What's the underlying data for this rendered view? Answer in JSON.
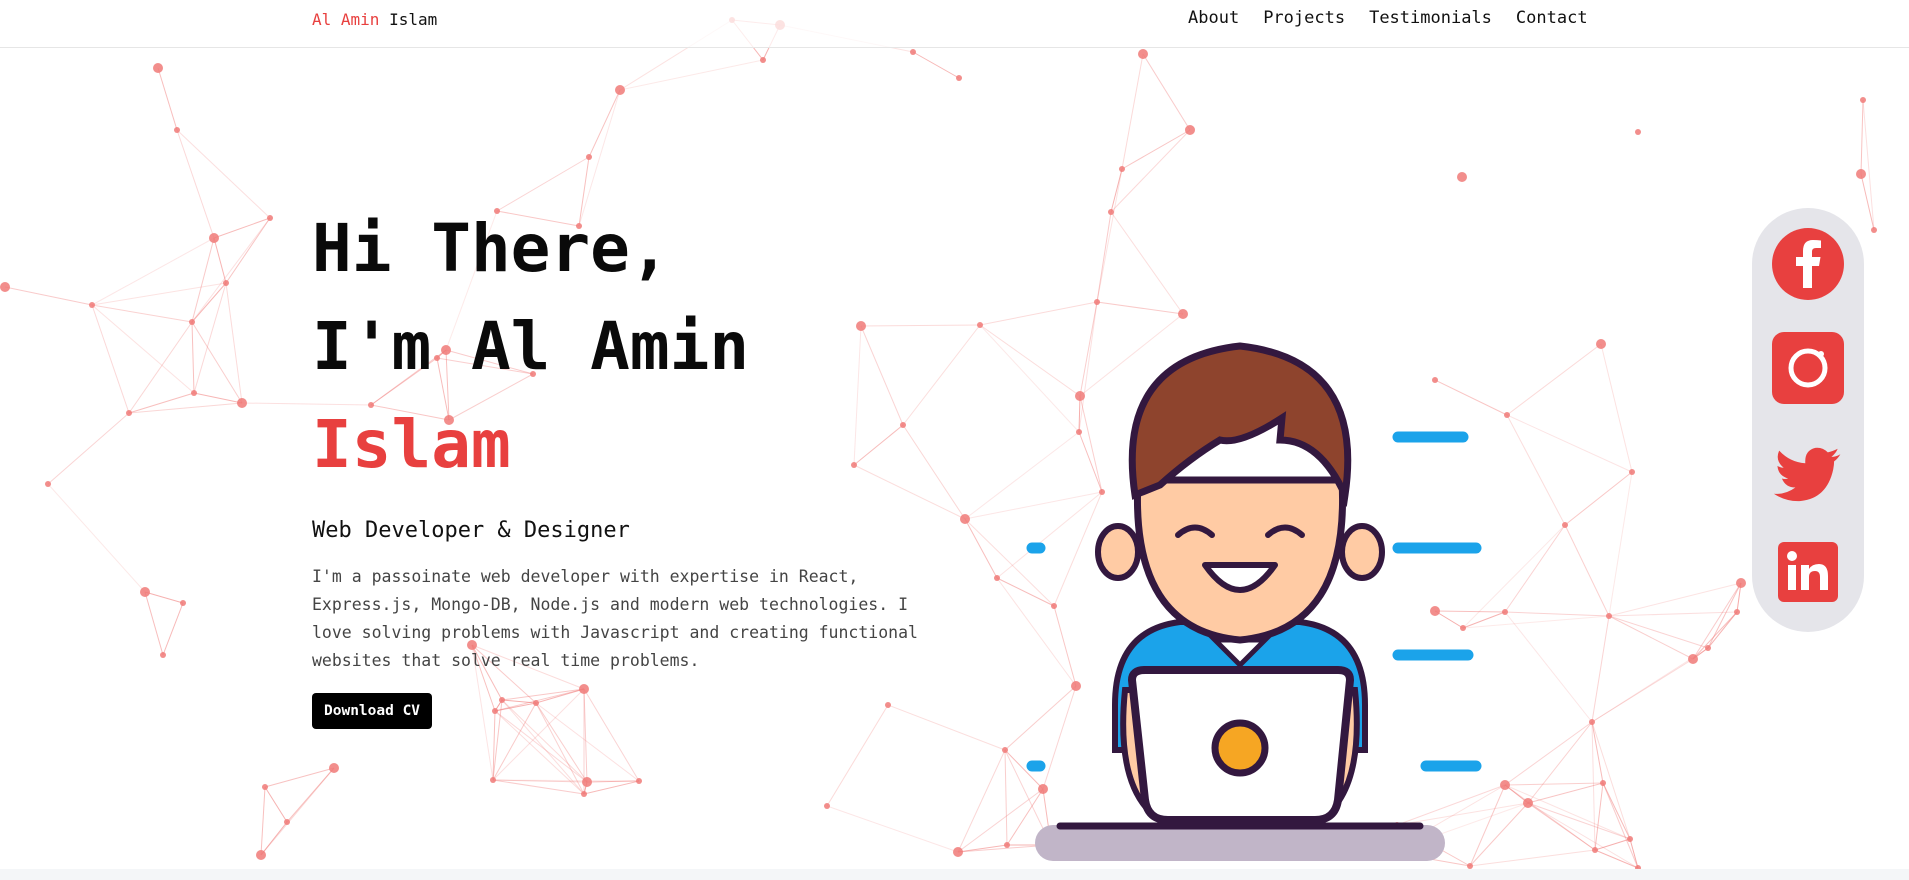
{
  "nav": {
    "brand_first": "Al Amin",
    "brand_last": "Islam",
    "links": [
      "About",
      "Projects",
      "Testimonials",
      "Contact"
    ]
  },
  "hero": {
    "line1": "Hi There,",
    "line2": "I'm Al Amin",
    "line3": "Islam",
    "role": "Web Developer & Designer",
    "description": "I'm a passoinate web developer with expertise in React, Express.js, Mongo-DB, Node.js and modern web technologies. I love solving problems with Javascript and creating functional websites that solve real time problems.",
    "cta": "Download CV"
  },
  "social": [
    {
      "name": "facebook",
      "icon": "facebook-icon"
    },
    {
      "name": "instagram",
      "icon": "instagram-icon"
    },
    {
      "name": "twitter",
      "icon": "twitter-icon"
    },
    {
      "name": "linkedin",
      "icon": "linkedin-icon"
    }
  ],
  "colors": {
    "accent": "#e8403f",
    "network": "#f07a78",
    "social_bg": "#e5e5ea",
    "hair": "#8e442d",
    "shirt": "#1ba3ea",
    "skin": "#ffcba4",
    "outline": "#33183f"
  }
}
